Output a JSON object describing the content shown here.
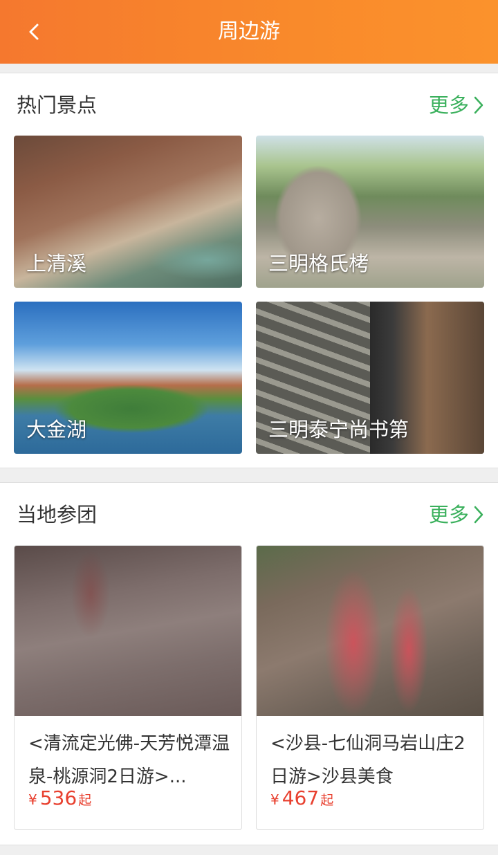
{
  "header": {
    "title": "周边游"
  },
  "hot_spots": {
    "title": "热门景点",
    "more_label": "更多",
    "items": [
      {
        "name": "上清溪"
      },
      {
        "name": "三明格氏栲"
      },
      {
        "name": "大金湖"
      },
      {
        "name": "三明泰宁尚书第"
      }
    ]
  },
  "local_tours": {
    "title": "当地参团",
    "more_label": "更多",
    "items": [
      {
        "name": "<清流定光佛-天芳悦潭温泉-桃源洞2日游>...",
        "currency": "¥",
        "price": "536",
        "price_suffix": "起"
      },
      {
        "name": "<沙县-七仙洞马岩山庄2日游>沙县美食",
        "currency": "¥",
        "price": "467",
        "price_suffix": "起"
      }
    ]
  }
}
